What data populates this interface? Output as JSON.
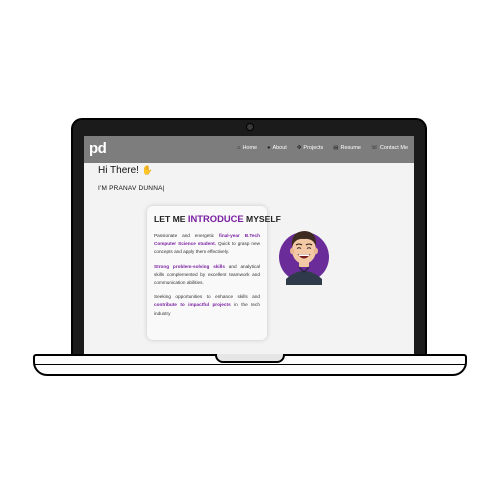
{
  "site": {
    "logo": "pd"
  },
  "nav": {
    "items": [
      {
        "label": "Home",
        "icon": "home-icon",
        "glyph": "⌂"
      },
      {
        "label": "About",
        "icon": "user-icon",
        "glyph": "●"
      },
      {
        "label": "Projects",
        "icon": "projects-icon",
        "glyph": "✥"
      },
      {
        "label": "Resume",
        "icon": "document-icon",
        "glyph": "▤"
      },
      {
        "label": "Contact Me",
        "icon": "phone-icon",
        "glyph": "☏"
      }
    ]
  },
  "hero": {
    "greeting": "Hi There!",
    "wave_emoji": "✋",
    "typed_text": "I'M PRANAV DUNNA|"
  },
  "intro_card": {
    "title_pre": "LET ME",
    "title_accent": "INTRODUCE",
    "title_post": "MYSELF",
    "p1_a": "Passionate and energetic",
    "p1_hl": "final-year B.Tech Computer Science student.",
    "p1_b": "Quick to grasp new concepts and apply them effectively.",
    "p2_hl": "Strong problem-solving skills",
    "p2_b": "and analytical skills complemented by excellent teamwork and communication abilities.",
    "p3_a": "Seeking opportunities to enhance skills and",
    "p3_hl": "contribute to impactful projects",
    "p3_b": "in the tech industry"
  },
  "colors": {
    "accent": "#7a1fa2",
    "navbar": "#7d7d7d",
    "screen_bg": "#f3f3f3",
    "avatar_bg": "#6a2c99"
  }
}
